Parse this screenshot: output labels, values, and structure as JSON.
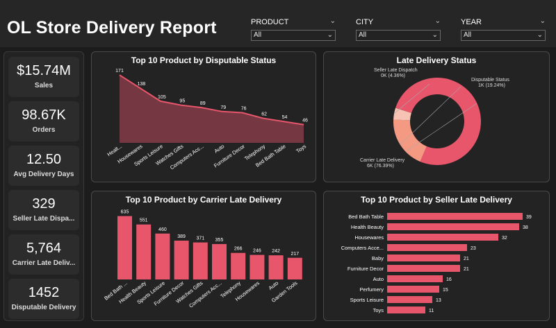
{
  "header": {
    "title": "OL Store Delivery Report"
  },
  "slicers": [
    {
      "label": "PRODUCT",
      "value": "All"
    },
    {
      "label": "CITY",
      "value": "All"
    },
    {
      "label": "YEAR",
      "value": "All"
    }
  ],
  "kpis": [
    {
      "value": "$15.74M",
      "label": "Sales"
    },
    {
      "value": "98.67K",
      "label": "Orders"
    },
    {
      "value": "12.50",
      "label": "Avg Delivery Days"
    },
    {
      "value": "329",
      "label": "Seller Late Dispa..."
    },
    {
      "value": "5,764",
      "label": "Carrier Late Deliv..."
    },
    {
      "value": "1452",
      "label": "Disputable Delivery"
    }
  ],
  "colors": {
    "accent": "#e8566c",
    "area_fill": "#7a3a44",
    "donut_light": "#f49a82",
    "donut_pale": "#f7c1b3"
  },
  "chart_data": [
    {
      "type": "area",
      "title": "Top 10 Product by Disputable Status",
      "categories": [
        "Healt...",
        "Housewares",
        "Sports Leisure",
        "Watches Gifts",
        "Computers Acc...",
        "Auto",
        "Furniture Decor",
        "Telephony",
        "Bed Bath Table",
        "Toys"
      ],
      "values": [
        171,
        138,
        105,
        95,
        89,
        79,
        76,
        62,
        54,
        46
      ],
      "ylim": [
        0,
        180
      ]
    },
    {
      "type": "pie",
      "title": "Late Delivery Status",
      "slices": [
        {
          "name": "Carrier Late Delivery",
          "value_label": "6K (76.39%)",
          "value": 76.39
        },
        {
          "name": "Disputable Status",
          "value_label": "1K (19.24%)",
          "value": 19.24
        },
        {
          "name": "Seller Late Dispatch",
          "value_label": "0K (4.36%)",
          "value": 4.36
        }
      ]
    },
    {
      "type": "bar",
      "title": "Top 10 Product by Carrier Late Delivery",
      "categories": [
        "Bed Bath ...",
        "Health Beauty",
        "Sports Leisure",
        "Furniture Decor",
        "Watches Gifts",
        "Computers Acc...",
        "Telephony",
        "Housewares",
        "Auto",
        "Garden Tools"
      ],
      "values": [
        635,
        551,
        460,
        389,
        371,
        355,
        266,
        246,
        242,
        217
      ],
      "ylim": [
        0,
        660
      ]
    },
    {
      "type": "bar",
      "orientation": "horizontal",
      "title": "Top 10 Product by Seller Late Delivery",
      "categories": [
        "Bed Bath Table",
        "Health Beauty",
        "Housewares",
        "Computers Acce...",
        "Baby",
        "Furniture Decor",
        "Auto",
        "Perfumery",
        "Sports Leisure",
        "Toys"
      ],
      "values": [
        39,
        38,
        32,
        23,
        21,
        21,
        16,
        15,
        13,
        11
      ],
      "xlim": [
        0,
        40
      ]
    }
  ]
}
